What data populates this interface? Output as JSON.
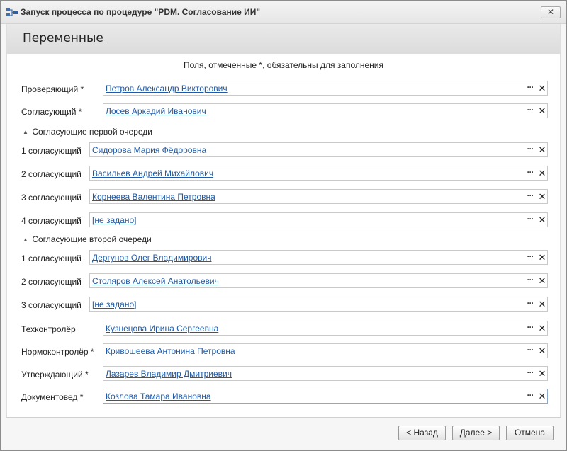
{
  "window": {
    "title": "Запуск процесса по процедуре \"PDM. Согласование ИИ\"",
    "close_label": "✕"
  },
  "page": {
    "title": "Переменные",
    "hint": "Поля, отмеченные *, обязательны для заполнения"
  },
  "fields": {
    "checker": {
      "label": "Проверяющий *",
      "value": "Петров Александр Викторович"
    },
    "approver": {
      "label": "Согласующий *",
      "value": "Лосев Аркадий Иванович"
    },
    "tech_control": {
      "label": "Техконтролёр",
      "value": "Кузнецова Ирина Сергеевна"
    },
    "norm_control": {
      "label": "Нормоконтролёр *",
      "value": "Кривошеева Антонина Петровна"
    },
    "confirmer": {
      "label": "Утверждающий *",
      "value": "Лазарев Владимир Дмитриевич"
    },
    "doc_controller": {
      "label": "Документовед *",
      "value": "Козлова Тамара Ивановна"
    }
  },
  "group1": {
    "title": "Согласующие первой очереди",
    "rows": [
      {
        "label": "1 согласующий",
        "value": "Сидорова Мария Фёдоровна"
      },
      {
        "label": "2 согласующий",
        "value": "Васильев Андрей Михайлович"
      },
      {
        "label": "3 согласующий",
        "value": "Корнеева Валентина Петровна"
      },
      {
        "label": "4 согласующий",
        "value": "[не задано]"
      }
    ]
  },
  "group2": {
    "title": "Согласующие второй очереди",
    "rows": [
      {
        "label": "1 согласующий",
        "value": "Дергунов Олег Владимирович"
      },
      {
        "label": "2 согласующий",
        "value": "Столяров Алексей Анатольевич"
      },
      {
        "label": "3 согласующий",
        "value": "[не задано]"
      }
    ]
  },
  "icons": {
    "more": "···",
    "clear": "✕",
    "collapse": "▲"
  },
  "buttons": {
    "back": "< Назад",
    "next": "Далее >",
    "cancel": "Отмена"
  },
  "colors": {
    "link": "#1f5aa6",
    "header_band": "#dcdcdc"
  }
}
